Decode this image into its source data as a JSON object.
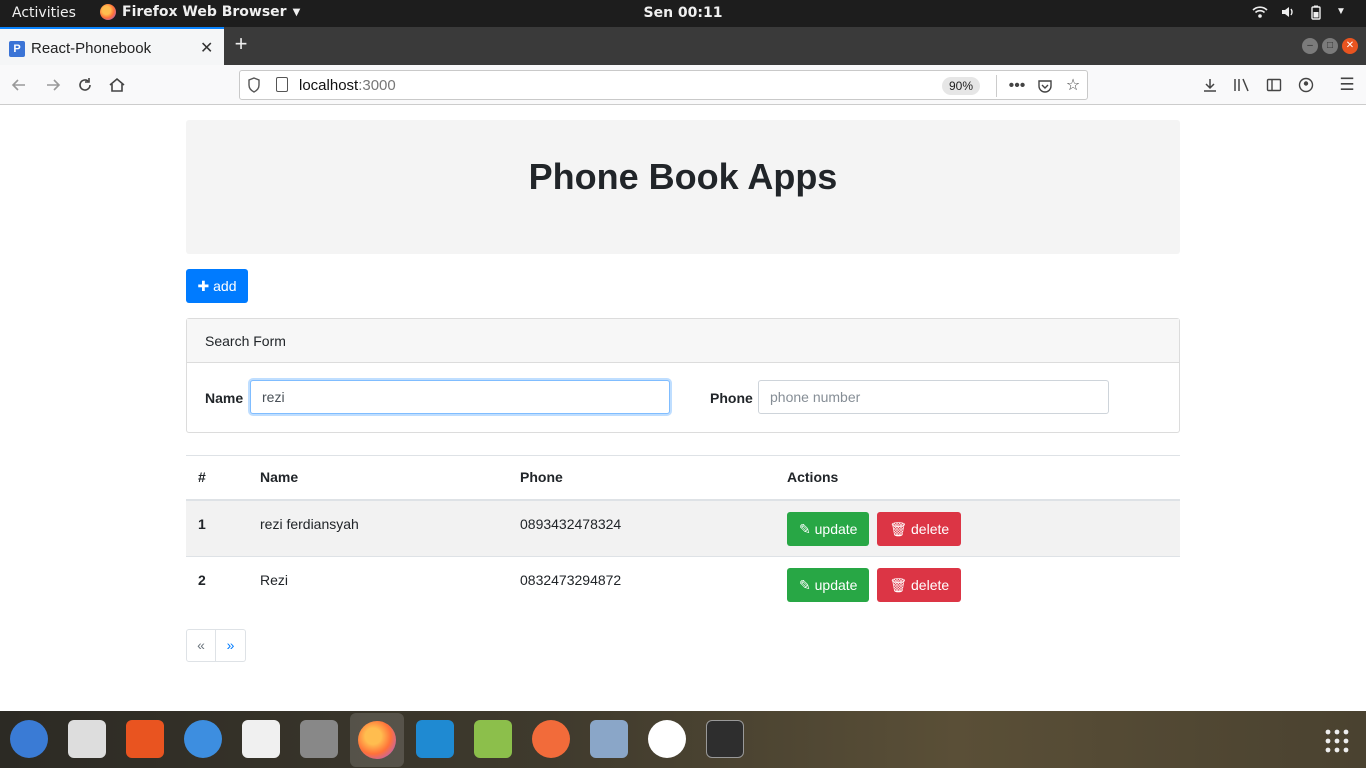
{
  "topbar": {
    "activities": "Activities",
    "app_name": "Firefox Web Browser",
    "clock": "Sen 00:11"
  },
  "browser": {
    "tab_title": "React-Phonebook",
    "tab_favicon": "P",
    "url_host": "localhost",
    "url_port": ":3000",
    "zoom": "90%"
  },
  "page": {
    "title": "Phone Book Apps",
    "add_label": "add",
    "search": {
      "header": "Search Form",
      "name_label": "Name",
      "name_value": "rezi",
      "phone_label": "Phone",
      "phone_placeholder": "phone number"
    },
    "table": {
      "headers": [
        "#",
        "Name",
        "Phone",
        "Actions"
      ],
      "rows": [
        {
          "no": "1",
          "name": "rezi ferdiansyah",
          "phone": "0893432478324"
        },
        {
          "no": "2",
          "name": "Rezi",
          "phone": "0832473294872"
        }
      ],
      "update_label": "update",
      "delete_label": "delete"
    },
    "pagination": {
      "prev": "«",
      "next": "»"
    }
  },
  "colors": {
    "primary": "#007bff",
    "success": "#28a745",
    "danger": "#dc3545",
    "ubuntu_orange": "#e95420"
  }
}
